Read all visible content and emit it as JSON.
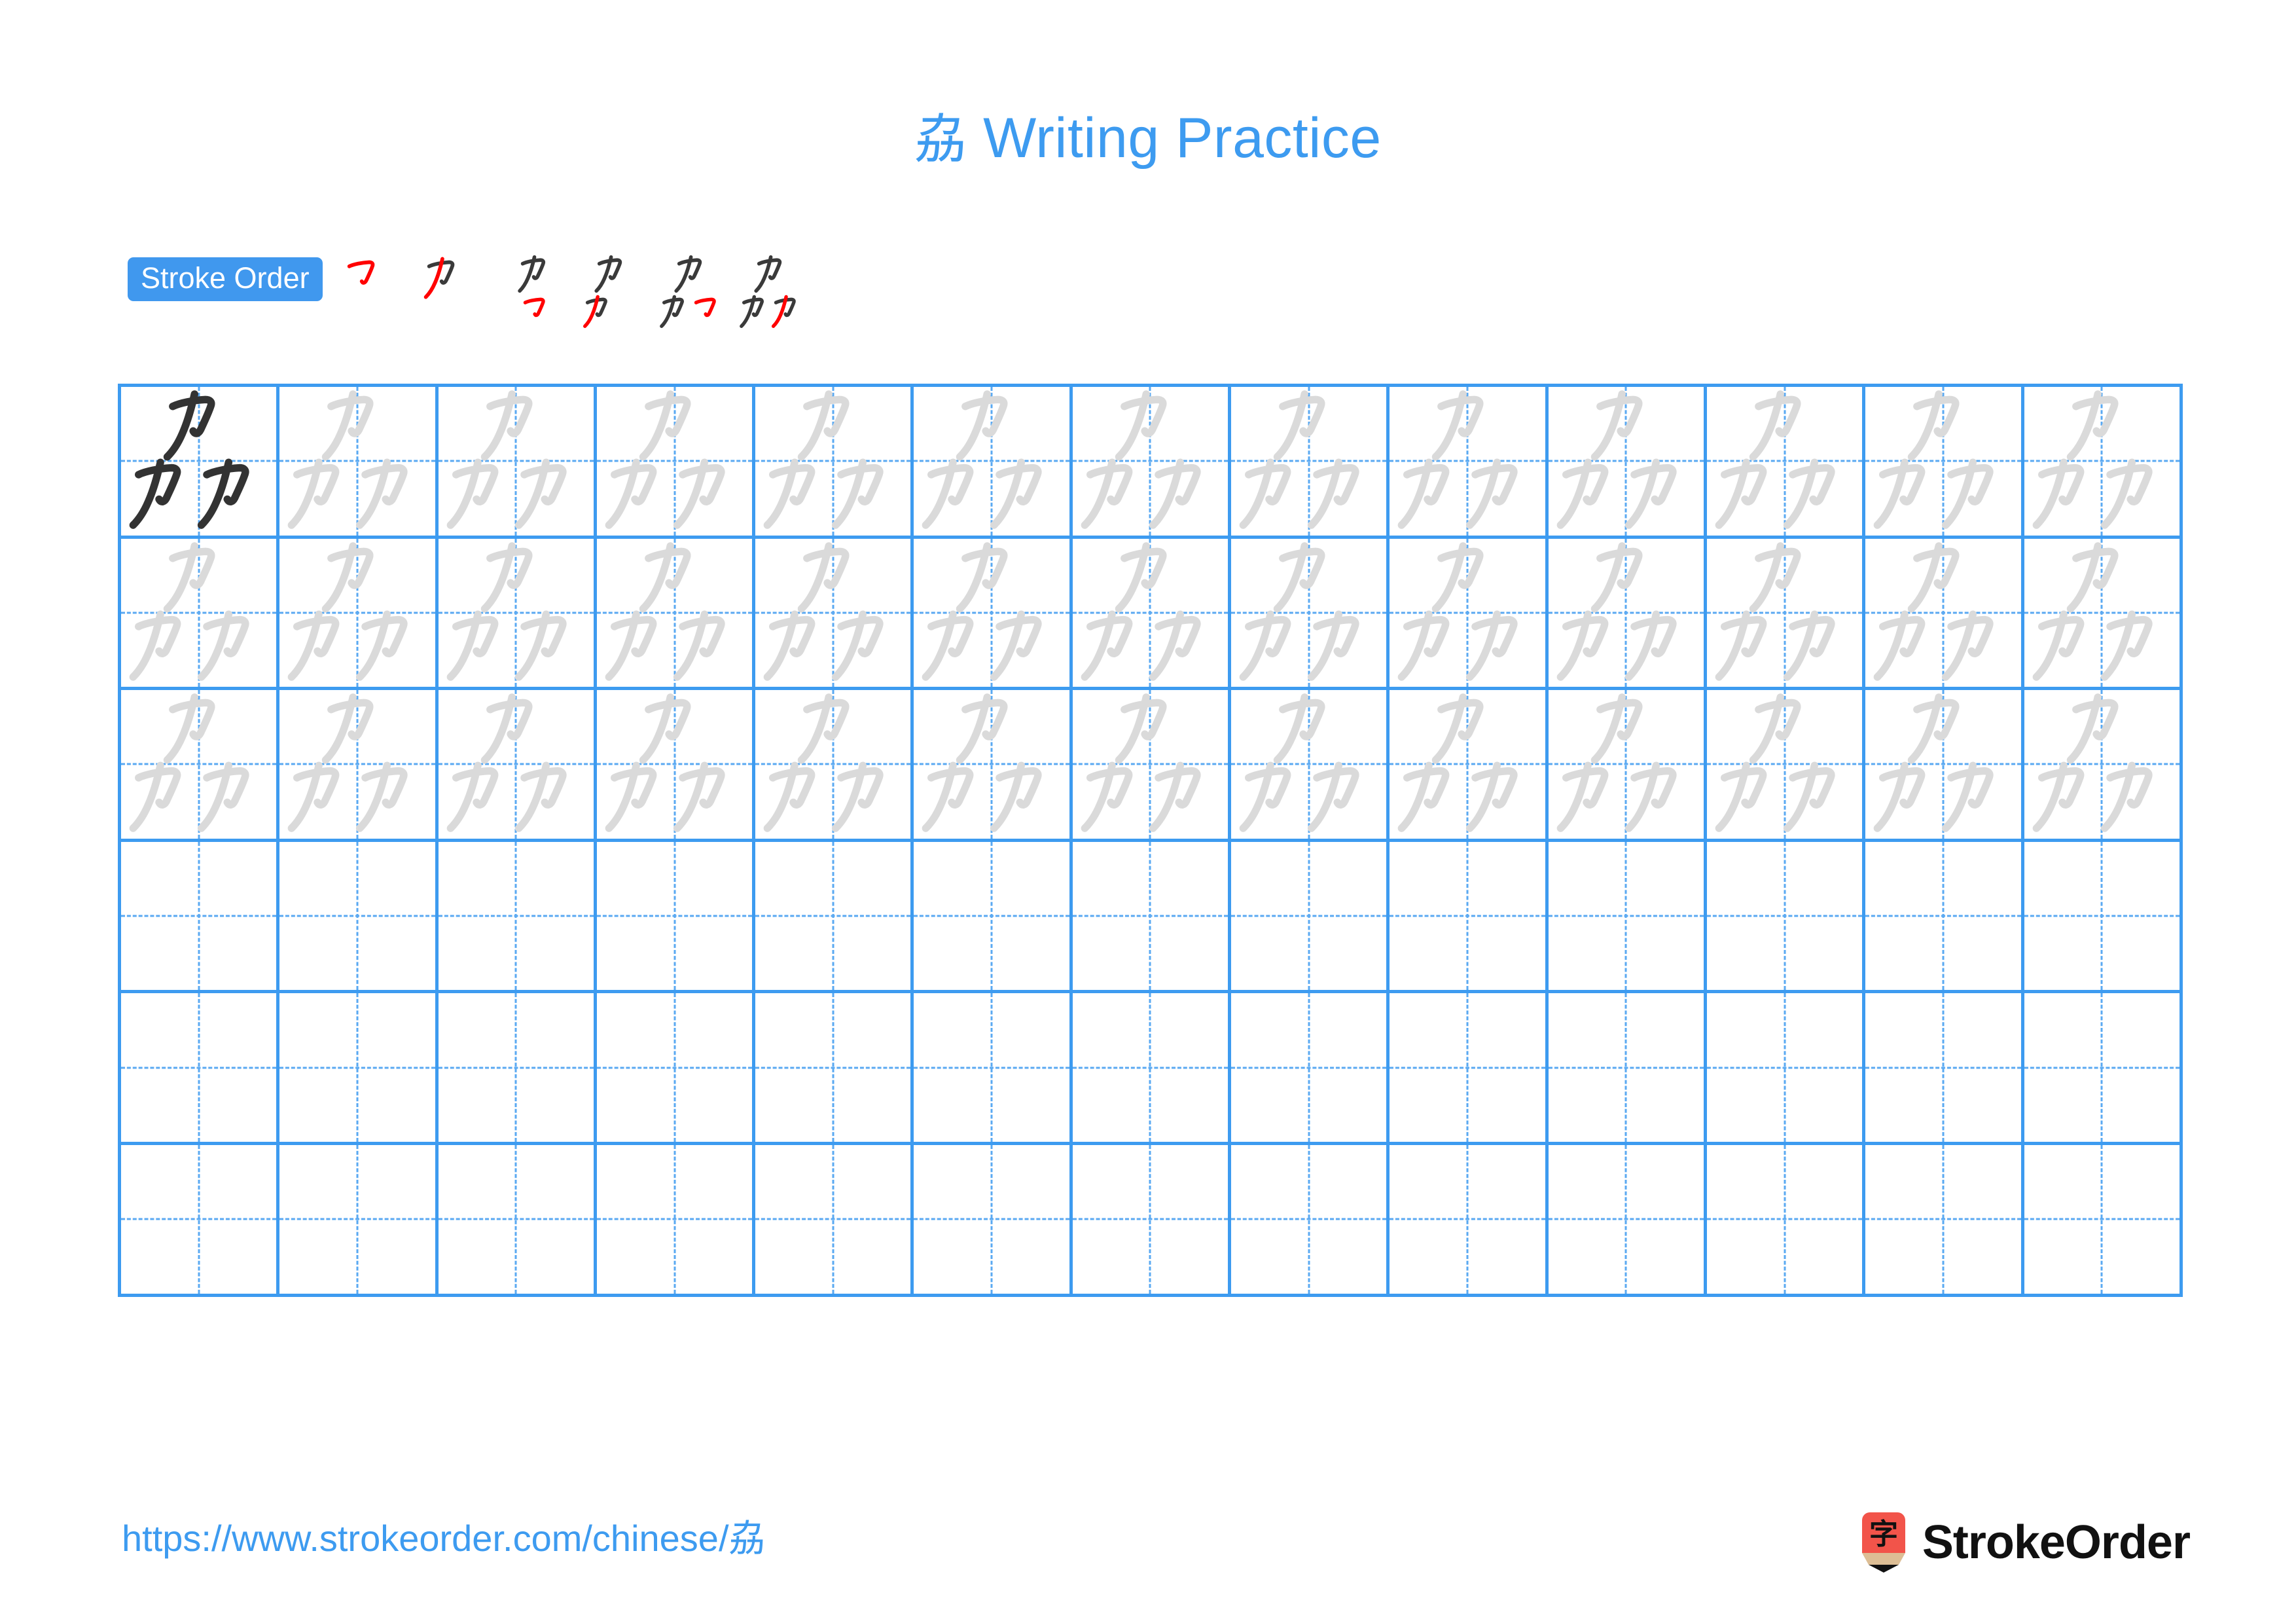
{
  "document": {
    "character": "劦",
    "title_suffix": "Writing Practice",
    "title_full": "劦 Writing Practice",
    "accent_color": "#3d9bf0",
    "grid_line_color": "#3d9bf0",
    "guide_line_color": "#5aa9f2",
    "traced_char_color": "#dadada",
    "model_char_color": "#333333",
    "stroke_new_color": "#ff0000",
    "stroke_done_color": "#3a3a3a"
  },
  "stroke_order": {
    "badge_label": "Stroke Order",
    "stroke_count": 6,
    "steps": [
      {
        "index": 1,
        "strokes_shown": 1,
        "new_stroke": 1
      },
      {
        "index": 2,
        "strokes_shown": 2,
        "new_stroke": 2
      },
      {
        "index": 3,
        "strokes_shown": 3,
        "new_stroke": 3
      },
      {
        "index": 4,
        "strokes_shown": 4,
        "new_stroke": 4
      },
      {
        "index": 5,
        "strokes_shown": 5,
        "new_stroke": 5
      },
      {
        "index": 6,
        "strokes_shown": 6,
        "new_stroke": 6
      }
    ]
  },
  "practice_grid": {
    "columns": 13,
    "rows": 6,
    "filled_rows": 3,
    "empty_rows": 3,
    "first_cell_style": "model",
    "cell_contents": [
      [
        "model",
        "trace",
        "trace",
        "trace",
        "trace",
        "trace",
        "trace",
        "trace",
        "trace",
        "trace",
        "trace",
        "trace",
        "trace"
      ],
      [
        "trace",
        "trace",
        "trace",
        "trace",
        "trace",
        "trace",
        "trace",
        "trace",
        "trace",
        "trace",
        "trace",
        "trace",
        "trace"
      ],
      [
        "trace",
        "trace",
        "trace",
        "trace",
        "trace",
        "trace",
        "trace",
        "trace",
        "trace",
        "trace",
        "trace",
        "trace",
        "trace"
      ],
      [
        "empty",
        "empty",
        "empty",
        "empty",
        "empty",
        "empty",
        "empty",
        "empty",
        "empty",
        "empty",
        "empty",
        "empty",
        "empty"
      ],
      [
        "empty",
        "empty",
        "empty",
        "empty",
        "empty",
        "empty",
        "empty",
        "empty",
        "empty",
        "empty",
        "empty",
        "empty",
        "empty"
      ],
      [
        "empty",
        "empty",
        "empty",
        "empty",
        "empty",
        "empty",
        "empty",
        "empty",
        "empty",
        "empty",
        "empty",
        "empty",
        "empty"
      ]
    ]
  },
  "footer": {
    "url": "https://www.strokeorder.com/chinese/劦",
    "brand_name": "StrokeOrder",
    "brand_mark_char": "字",
    "brand_mark_color": "#f2544a",
    "brand_mark_tip_color": "#ddbe95"
  }
}
